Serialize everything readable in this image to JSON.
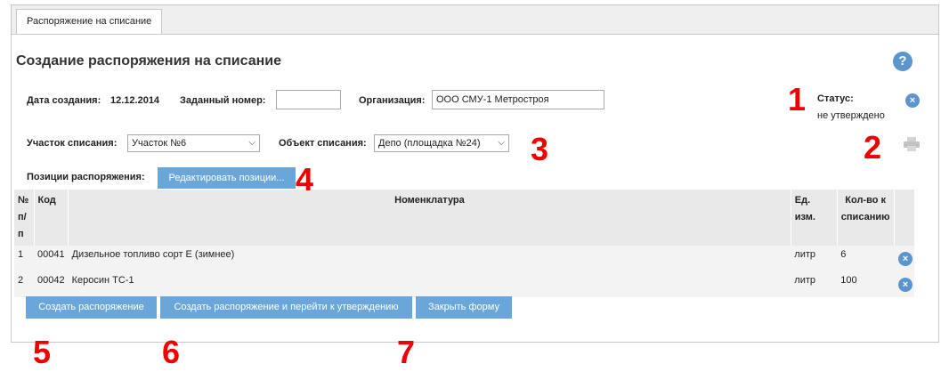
{
  "tab": {
    "label": "Распоряжение на списание"
  },
  "title": "Создание распоряжения на списание",
  "help_icon": "?",
  "created": {
    "label": "Дата создания:",
    "value": "12.12.2014"
  },
  "number": {
    "label": "Заданный номер:",
    "value": ""
  },
  "org": {
    "label": "Организация:",
    "value": "ООО СМУ-1 Метростроя"
  },
  "status": {
    "label": "Статус:",
    "value": "не утверждено"
  },
  "site": {
    "label": "Участок списания:",
    "selected": "Участок №6"
  },
  "object": {
    "label": "Объект списания:",
    "selected": "Депо (площадка №24)"
  },
  "positions": {
    "label": "Позиции распоряжения:",
    "edit_button": "Редактировать позиции..."
  },
  "table": {
    "headers": {
      "num_line1": "№",
      "num_line2": "п/п",
      "code": "Код",
      "name": "Номенклатура",
      "unit": "Ед. изм.",
      "qty_line1": "Кол-во к",
      "qty_line2": "списанию"
    },
    "rows": [
      {
        "num": "1",
        "code": "00041",
        "name": "Дизельное топливо сорт Е (зимнее)",
        "unit": "литр",
        "qty": "6"
      },
      {
        "num": "2",
        "code": "00042",
        "name": "Керосин ТС-1",
        "unit": "литр",
        "qty": "100"
      }
    ]
  },
  "buttons": {
    "create": "Создать распоряжение",
    "create_and_approve": "Создать распоряжение и перейти к утверждению",
    "close": "Закрыть форму"
  },
  "annotations": [
    "1",
    "2",
    "3",
    "4",
    "5",
    "6",
    "7"
  ],
  "colors": {
    "accent": "#6aa6d9",
    "icon_blue": "#5a95cf",
    "annotation": "#ee0000"
  }
}
